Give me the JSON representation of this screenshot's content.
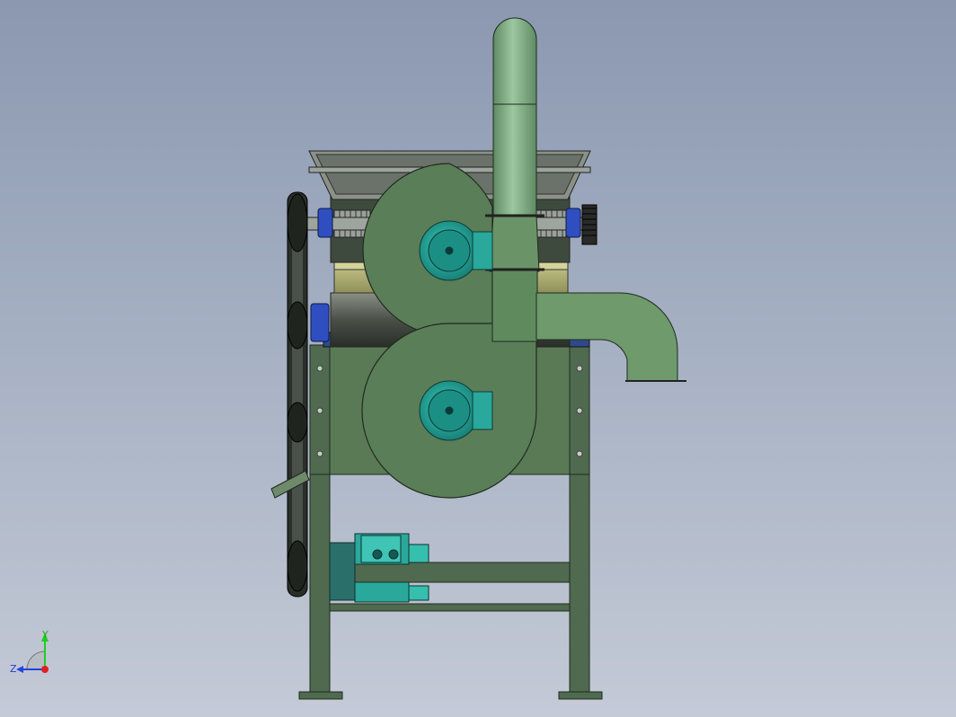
{
  "viewport": {
    "background_top": "#8b98b0",
    "background_bottom": "#c4cad6"
  },
  "model": {
    "frame_color": "#4f6a4f",
    "body_color": "#5a7a55",
    "duct_color": "#6f9a72",
    "motor_color": "#2bb5a8",
    "bearing_color": "#2f4fc0",
    "belt_color": "#2a2f2a",
    "hopper_color": "#8a9288"
  },
  "triad": {
    "y_label": "Y",
    "z_label": "Z",
    "y_axis_color": "#22cc22",
    "z_axis_color": "#2244dd",
    "origin_color": "#dd2222"
  }
}
